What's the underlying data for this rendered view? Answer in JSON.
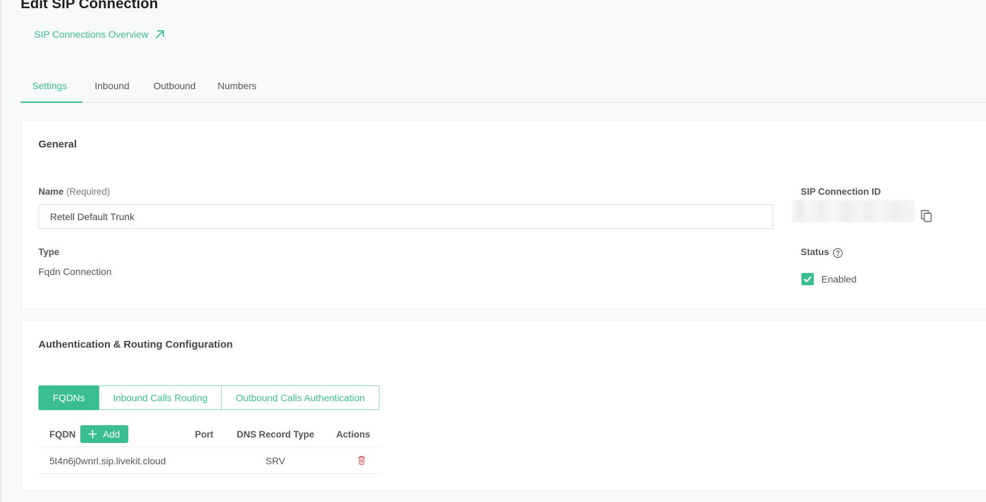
{
  "header": {
    "title": "Edit SIP Connection",
    "overview_link": "SIP Connections Overview"
  },
  "tabs": [
    "Settings",
    "Inbound",
    "Outbound",
    "Numbers"
  ],
  "general": {
    "title": "General",
    "name_label": "Name",
    "name_required": "(Required)",
    "name_value": "Retell Default Trunk",
    "type_label": "Type",
    "type_value": "Fqdn Connection",
    "sip_id_label": "SIP Connection ID",
    "status_label": "Status",
    "status_value": "Enabled",
    "status_checked": true
  },
  "auth": {
    "title": "Authentication & Routing Configuration",
    "segments": [
      "FQDNs",
      "Inbound Calls Routing",
      "Outbound Calls Authentication"
    ],
    "table": {
      "headers": [
        "FQDN",
        "Port",
        "DNS Record Type",
        "Actions"
      ],
      "add_label": "Add",
      "rows": [
        {
          "fqdn": "5t4n6j0wnrl.sip.livekit.cloud",
          "port": "",
          "dns_record_type": "SRV"
        }
      ]
    }
  },
  "colors": {
    "accent": "#3bbf91",
    "danger": "#e05a5a"
  }
}
